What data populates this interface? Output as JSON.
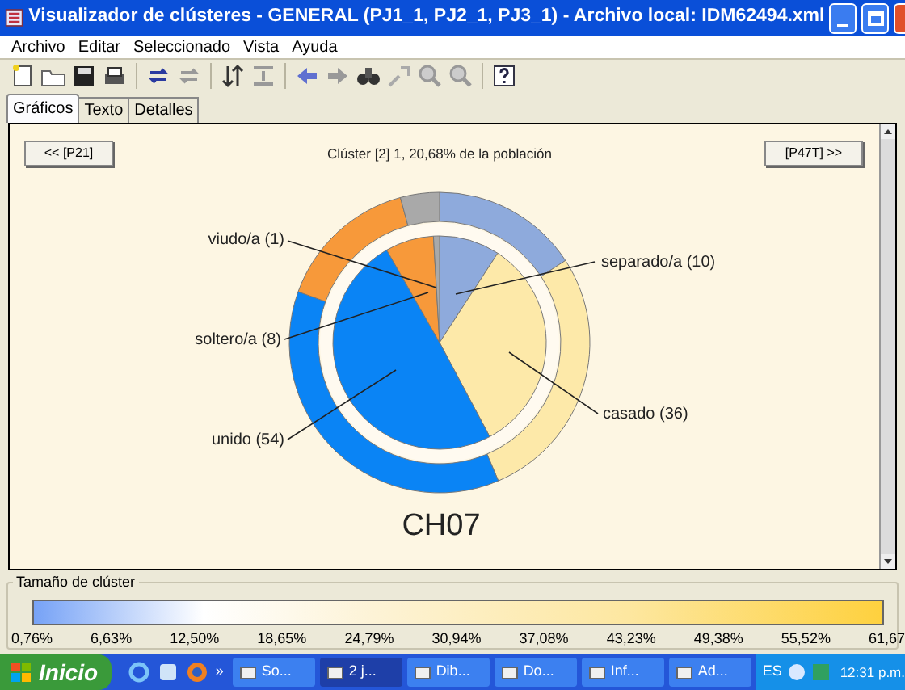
{
  "window": {
    "title": "Visualizador de clústeres - GENERAL (PJ1_1, PJ2_1, PJ3_1) - Archivo local: IDM62494.xml"
  },
  "menu": [
    "Archivo",
    "Editar",
    "Seleccionado",
    "Vista",
    "Ayuda"
  ],
  "tabs": [
    {
      "label": "Gráficos",
      "selected": true
    },
    {
      "label": "Texto",
      "selected": false
    },
    {
      "label": "Detalles",
      "selected": false
    }
  ],
  "chart_panel": {
    "prev_button": "<< [P21]",
    "next_button": "[P47T] >>",
    "title": "Clúster [2] 1, 20,68% de la población",
    "center_label": "CH07",
    "chart_data": {
      "type": "donut",
      "categories": [
        "separado/a (10)",
        "casado (36)",
        "unido (54)",
        "soltero/a (8)",
        "viudo/a (1)"
      ],
      "colors": [
        "#8eaadc",
        "#fde9a9",
        "#0a84f5",
        "#f7993a",
        "#a9a9a9"
      ],
      "series": [
        {
          "values": [
            10,
            36,
            54,
            8,
            1
          ]
        },
        {
          "values": [
            15.8,
            27.8,
            36.9,
            15.3,
            4.2
          ]
        }
      ]
    }
  },
  "legend": {
    "title": "Tamaño de clúster",
    "ticks": [
      "0,76%",
      "6,63%",
      "12,50%",
      "18,65%",
      "24,79%",
      "30,94%",
      "37,08%",
      "43,23%",
      "49,38%",
      "55,52%",
      "61,67"
    ]
  },
  "taskbar": {
    "start": "Inicio",
    "overflow": "»",
    "tasks": [
      {
        "label": "So...",
        "selected": false
      },
      {
        "label": "2 j...",
        "selected": true
      },
      {
        "label": "Dib...",
        "selected": false
      },
      {
        "label": "Do...",
        "selected": false
      },
      {
        "label": "Inf...",
        "selected": false
      },
      {
        "label": "Ad...",
        "selected": false
      }
    ],
    "language": "ES",
    "clock": "12:31 p.m."
  }
}
